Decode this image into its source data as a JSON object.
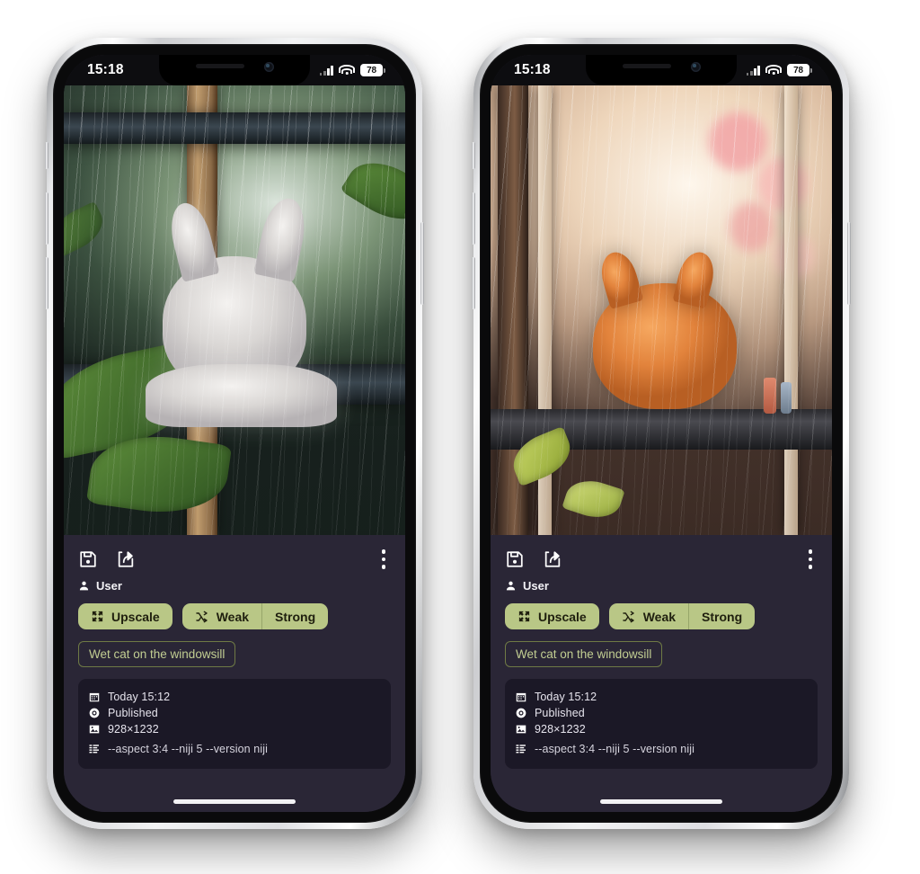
{
  "app": {
    "panel_bg": "#2a2636",
    "meta_bg": "#1b1826",
    "accent": "#b9c786",
    "accent_text": "#c2ce92",
    "accent_border": "#6f7a45"
  },
  "status_bar": {
    "time": "15:18",
    "battery_level": "78",
    "signal_icon": "cellular-signal-icon",
    "wifi_icon": "wifi-icon",
    "battery_icon": "battery-icon"
  },
  "phones": [
    {
      "id": "left",
      "artwork_alt": "Anime white cat-girl resting on a windowsill in the rain surrounded by green leaves",
      "actions": {
        "save_icon": "save-icon",
        "share_icon": "share-icon",
        "menu_icon": "more-options-icon"
      },
      "author": {
        "icon": "user-icon",
        "name": "User"
      },
      "buttons": {
        "upscale": {
          "label": "Upscale",
          "icon": "expand-arrows-icon"
        },
        "variations": {
          "icon": "shuffle-icon",
          "weak_label": "Weak",
          "strong_label": "Strong"
        }
      },
      "prompt": "Wet cat on the windowsill",
      "meta": [
        {
          "icon": "calendar-icon",
          "text": "Today 15:12"
        },
        {
          "icon": "eye-icon",
          "text": "Published"
        },
        {
          "icon": "image-icon",
          "text": "928×1232"
        },
        {
          "icon": "list-icon",
          "text": "--aspect 3:4 --niji 5 --version niji"
        }
      ]
    },
    {
      "id": "right",
      "artwork_alt": "Anime orange fox-cat curled on a windowsill behind rain-streaked glass with pink blossoms outside",
      "actions": {
        "save_icon": "save-icon",
        "share_icon": "share-icon",
        "menu_icon": "more-options-icon"
      },
      "author": {
        "icon": "user-icon",
        "name": "User"
      },
      "buttons": {
        "upscale": {
          "label": "Upscale",
          "icon": "expand-arrows-icon"
        },
        "variations": {
          "icon": "shuffle-icon",
          "weak_label": "Weak",
          "strong_label": "Strong"
        }
      },
      "prompt": "Wet cat on the windowsill",
      "meta": [
        {
          "icon": "calendar-icon",
          "text": "Today 15:12"
        },
        {
          "icon": "eye-icon",
          "text": "Published"
        },
        {
          "icon": "image-icon",
          "text": "928×1232"
        },
        {
          "icon": "list-icon",
          "text": "--aspect 3:4 --niji 5 --version niji"
        }
      ]
    }
  ]
}
